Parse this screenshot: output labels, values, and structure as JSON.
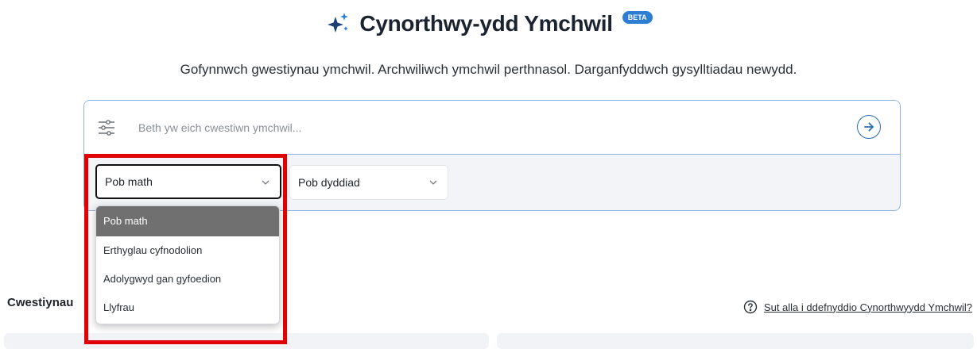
{
  "header": {
    "title": "Cynorthwy-ydd Ymchwil",
    "badge": "BETA",
    "subtitle": "Gofynnwch gwestiynau ymchwil. Archwiliwch ymchwil perthnasol. Darganfyddwch gysylltiadau newydd."
  },
  "search": {
    "placeholder": "Beth yw eich cwestiwn ymchwil...",
    "value": ""
  },
  "filters": {
    "type_selected": "Pob math",
    "date_selected": "Pob dyddiad",
    "type_options": [
      "Pob math",
      "Erthyglau cyfnodolion",
      "Adolygwyd gan gyfoedion",
      "Llyfrau"
    ]
  },
  "sections": {
    "questions_heading": "Cwestiynau",
    "help_link": "Sut alla i ddefnyddio Cynorthwyydd Ymchwil?"
  },
  "colors": {
    "accent": "#2d7dd2",
    "highlight": "#e00000",
    "selected_option": "#707070"
  },
  "icons": [
    "sparkle-icon",
    "filter-sliders-icon",
    "arrow-right-circle-icon",
    "chevron-down-icon",
    "question-circle-icon"
  ]
}
